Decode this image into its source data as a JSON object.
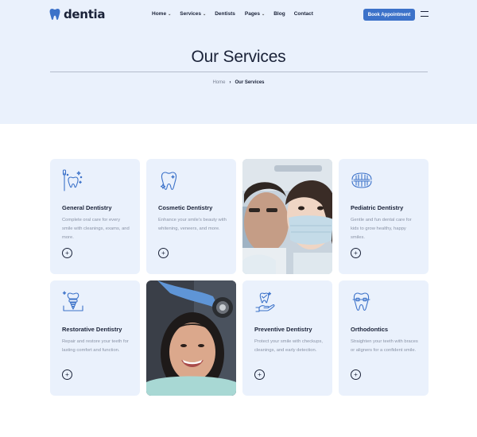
{
  "brand": {
    "name": "dentia",
    "accent": "#3c72c9",
    "dark": "#1a2238",
    "card_bg": "#eaf1fc"
  },
  "nav": {
    "items": [
      {
        "label": "Home",
        "dropdown": true
      },
      {
        "label": "Services",
        "dropdown": true
      },
      {
        "label": "Dentists",
        "dropdown": false
      },
      {
        "label": "Pages",
        "dropdown": true
      },
      {
        "label": "Blog",
        "dropdown": false
      },
      {
        "label": "Contact",
        "dropdown": false
      }
    ],
    "book_label": "Book Appointment",
    "caret": "⌄"
  },
  "hero": {
    "title": "Our Services",
    "breadcrumb": {
      "home": "Home",
      "separator": "›",
      "current": "Our Services"
    }
  },
  "services": [
    {
      "icon": "tooth-brush-icon",
      "title": "General Dentistry",
      "description": "Complete oral care for every smile with cleanings, exams, and more."
    },
    {
      "icon": "sparkle-tooth-icon",
      "title": "Cosmetic Dentistry",
      "description": "Enhance your smile's beauty with whitening, veneers, and more."
    },
    {
      "icon": "dentures-icon",
      "title": "Pediatric Dentistry",
      "description": "Gentle and fun dental care for kids to grow healthy, happy smiles."
    },
    {
      "icon": "implant-icon",
      "title": "Restorative Dentistry",
      "description": "Repair and restore your teeth for lasting comfort and function."
    },
    {
      "icon": "hand-tooth-icon",
      "title": "Preventive Dentistry",
      "description": "Protect your smile with checkups, cleanings, and early detection."
    },
    {
      "icon": "braces-icon",
      "title": "Orthodontics",
      "description": "Straighten your teeth with braces or aligners for a confident smile."
    }
  ],
  "plus_symbol": "+"
}
